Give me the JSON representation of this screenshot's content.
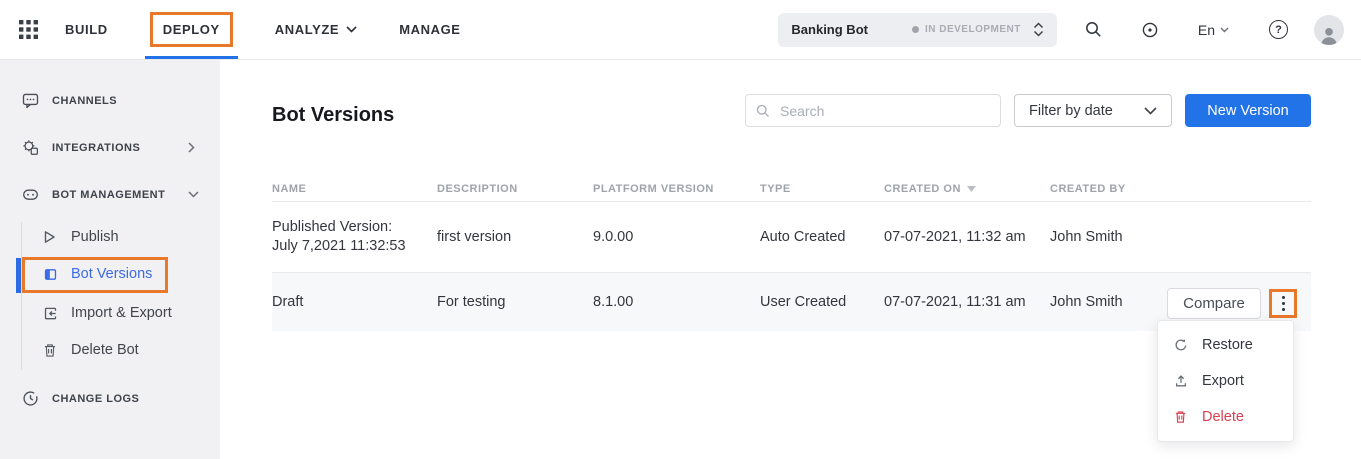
{
  "topnav": {
    "items": [
      {
        "label": "BUILD"
      },
      {
        "label": "DEPLOY",
        "active": true
      },
      {
        "label": "ANALYZE",
        "has_dropdown": true
      },
      {
        "label": "MANAGE"
      }
    ],
    "bot_selector": {
      "name": "Banking Bot",
      "status": "IN DEVELOPMENT"
    },
    "language": "En",
    "help_glyph": "?"
  },
  "sidebar": {
    "sections": [
      {
        "label": "CHANNELS"
      },
      {
        "label": "INTEGRATIONS",
        "collapsed": true
      },
      {
        "label": "BOT MANAGEMENT",
        "expanded": true
      }
    ],
    "bot_management_items": [
      {
        "label": "Publish"
      },
      {
        "label": "Bot Versions",
        "active": true
      },
      {
        "label": "Import & Export"
      },
      {
        "label": "Delete Bot"
      }
    ],
    "footer_item": {
      "label": "CHANGE LOGS"
    }
  },
  "main": {
    "title": "Bot Versions",
    "search": {
      "placeholder": "Search"
    },
    "filter_label": "Filter by date",
    "new_version_label": "New Version",
    "table": {
      "columns": [
        "NAME",
        "DESCRIPTION",
        "PLATFORM VERSION",
        "TYPE",
        "CREATED ON",
        "CREATED BY"
      ],
      "sorted_column": "CREATED ON",
      "rows": [
        {
          "name_line1": "Published Version:",
          "name_line2": "July 7,2021 11:32:53",
          "description": "first version",
          "platform_version": "9.0.00",
          "type": "Auto Created",
          "created_on": "07-07-2021, 11:32 am",
          "created_by": "John Smith"
        },
        {
          "name_line1": "Draft",
          "name_line2": "",
          "description": "For testing",
          "platform_version": "8.1.00",
          "type": "User Created",
          "created_on": "07-07-2021, 11:31 am",
          "created_by": "John Smith"
        }
      ],
      "row_actions": {
        "compare_label": "Compare"
      }
    },
    "context_menu": {
      "items": [
        {
          "label": "Restore",
          "icon": "restore-icon"
        },
        {
          "label": "Export",
          "icon": "export-icon"
        },
        {
          "label": "Delete",
          "icon": "trash-icon",
          "danger": true
        }
      ]
    }
  },
  "icons": {
    "apps-grid-icon": "3x3 squares",
    "search-icon": "magnifier",
    "target-icon": "circle with dot",
    "help-icon": "question in circle",
    "avatar-icon": "person silhouette",
    "chevron-down-icon": "v",
    "chevron-right-icon": ">",
    "chevron-updown-icon": "stacked chevrons",
    "kebab-icon": "vertical three dots",
    "sort-caret-icon": "down triangle"
  },
  "colors": {
    "annotation_orange": "#e8782a",
    "primary_blue": "#2373e8",
    "active_tab_underline": "#2272e8",
    "active_sidebar_blue": "#3d6ae8",
    "danger_red": "#d84052",
    "sidebar_bg": "#f1f1f3",
    "row_alt_bg": "#f7f8fa",
    "muted_text": "#9fa3aa"
  }
}
